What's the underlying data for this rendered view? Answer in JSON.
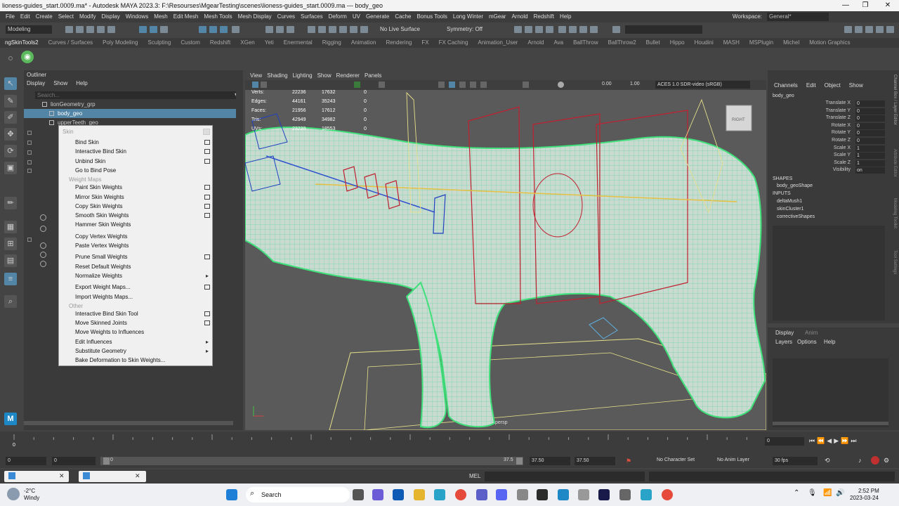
{
  "window": {
    "title": "lioness-guides_start.0009.ma* - Autodesk MAYA 2023.3: F:\\Resourses\\MgearTesting\\scenes\\lioness-guides_start.0009.ma  ---  body_geo"
  },
  "menubar": {
    "items": [
      "File",
      "Edit",
      "Create",
      "Select",
      "Modify",
      "Display",
      "Windows",
      "Mesh",
      "Edit Mesh",
      "Mesh Tools",
      "Mesh Display",
      "Curves",
      "Surfaces",
      "Deform",
      "UV",
      "Generate",
      "Cache",
      "Bonus Tools",
      "Long Winter",
      "mGear",
      "Arnold",
      "Redshift",
      "Help"
    ],
    "workspace_label": "Workspace:",
    "workspace_value": "General*"
  },
  "statusline": {
    "mode": "Modeling",
    "live_surface": "No Live Surface",
    "symmetry": "Symmetry: Off"
  },
  "shelf": {
    "tabs": [
      "ngSkinTools2",
      "Curves / Surfaces",
      "Poly Modeling",
      "Sculpting",
      "Custom",
      "Redshift",
      "XGen",
      "Yeti",
      "Enermental",
      "Rigging",
      "Animation",
      "Rendering",
      "FX",
      "FX Caching",
      "Animation_User",
      "Arnold",
      "Ava",
      "BallThrow",
      "BallThrow2",
      "Bullet",
      "Hippo",
      "Houdini",
      "MASH",
      "MSPlugin",
      "Michel",
      "Motion Graphics"
    ]
  },
  "outliner": {
    "title": "Outliner",
    "menu": [
      "Display",
      "Show",
      "Help"
    ],
    "search_placeholder": "Search...",
    "rows": [
      {
        "label": "lionGeometry_grp",
        "indent": 1
      },
      {
        "label": "body_geo",
        "indent": 2,
        "selected": true
      },
      {
        "label": "upperTeeth_geo",
        "indent": 2
      }
    ]
  },
  "context_menu": {
    "title": "Skin",
    "items": [
      {
        "label": "Bind Skin",
        "opt": true
      },
      {
        "label": "Interactive Bind Skin",
        "opt": true
      },
      {
        "label": "Unbind Skin",
        "opt": true
      },
      {
        "label": "Go to Bind Pose",
        "opt": false
      },
      {
        "section": "Weight Maps"
      },
      {
        "label": "Paint Skin Weights",
        "opt": true
      },
      {
        "label": "Mirror Skin Weights",
        "opt": true
      },
      {
        "label": "Copy Skin Weights",
        "opt": true
      },
      {
        "label": "Smooth Skin Weights",
        "opt": true
      },
      {
        "label": "Hammer Skin Weights",
        "opt": false
      },
      {
        "sep": true
      },
      {
        "label": "Copy Vertex Weights",
        "opt": false
      },
      {
        "label": "Paste Vertex Weights",
        "opt": false
      },
      {
        "sep": true
      },
      {
        "label": "Prune Small Weights",
        "opt": true
      },
      {
        "label": "Reset Default Weights",
        "opt": false
      },
      {
        "label": "Normalize Weights",
        "sub": true
      },
      {
        "sep": true
      },
      {
        "label": "Export Weight Maps...",
        "opt": true
      },
      {
        "label": "Import Weights Maps...",
        "opt": false
      },
      {
        "section": "Other"
      },
      {
        "label": "Interactive Bind Skin Tool",
        "opt": true
      },
      {
        "label": "Move Skinned Joints",
        "opt": true
      },
      {
        "label": "Move Weights to Influences",
        "opt": false
      },
      {
        "label": "Edit Influences",
        "sub": true
      },
      {
        "label": "Substitute Geometry",
        "sub": true
      },
      {
        "label": "Bake Deformation to Skin Weights...",
        "opt": false
      }
    ]
  },
  "viewport": {
    "menu": [
      "View",
      "Shading",
      "Lighting",
      "Show",
      "Renderer",
      "Panels"
    ],
    "exposure": "0.00",
    "gamma": "1.00",
    "colorspace": "ACES 1.0 SDR-video (sRGB)",
    "camera": "persp",
    "cube_label": "RIGHT",
    "hud": [
      {
        "label": "Verts:",
        "a": "22236",
        "b": "17632",
        "c": "0"
      },
      {
        "label": "Edges:",
        "a": "44161",
        "b": "35243",
        "c": "0"
      },
      {
        "label": "Faces:",
        "a": "21956",
        "b": "17612",
        "c": "0"
      },
      {
        "label": "Tris:",
        "a": "42949",
        "b": "34982",
        "c": "0"
      },
      {
        "label": "UVs:",
        "a": "23239",
        "b": "18553",
        "c": "0"
      }
    ]
  },
  "channelbox": {
    "menu": [
      "Channels",
      "Edit",
      "Object",
      "Show"
    ],
    "object": "body_geo",
    "attrs": [
      {
        "name": "Translate X",
        "value": "0"
      },
      {
        "name": "Translate Y",
        "value": "0"
      },
      {
        "name": "Translate Z",
        "value": "0"
      },
      {
        "name": "Rotate X",
        "value": "0"
      },
      {
        "name": "Rotate Y",
        "value": "0"
      },
      {
        "name": "Rotate Z",
        "value": "0"
      },
      {
        "name": "Scale X",
        "value": "1"
      },
      {
        "name": "Scale Y",
        "value": "1"
      },
      {
        "name": "Scale Z",
        "value": "1"
      },
      {
        "name": "Visibility",
        "value": "on"
      }
    ],
    "shapes_header": "SHAPES",
    "shape": "body_geoShape",
    "inputs_header": "INPUTS",
    "inputs": [
      "deltaMush1",
      "skinCluster1",
      "correctiveShapes"
    ],
    "side_tabs": [
      "Channel Box / Layer Editor",
      "Attribute Editor",
      "Modeling Toolkit",
      "Tool Settings"
    ]
  },
  "layers": {
    "tabs": [
      "Display",
      "Anim"
    ],
    "menu": [
      "Layers",
      "Options",
      "Help"
    ]
  },
  "timeline": {
    "start": "0",
    "current": "0",
    "range_start": "0",
    "range_inner_start": "0",
    "range_inner_end": "37.5",
    "end1": "37.50",
    "end2": "37.50",
    "no_char": "No Character Set",
    "no_anim": "No Anim Layer",
    "fps": "30 fps",
    "frame_field": "0"
  },
  "cmdline": {
    "lang": "MEL"
  },
  "taskbar": {
    "temp": "-2°C",
    "weather": "Windy",
    "search": "Search",
    "time": "2:52 PM",
    "date": "2023-03-24"
  }
}
